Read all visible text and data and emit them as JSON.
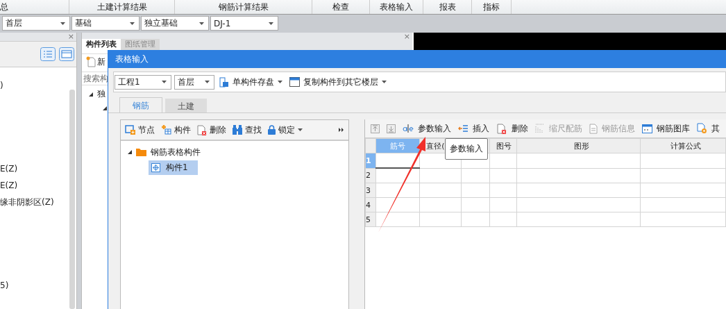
{
  "menu_tabs": [
    {
      "label": "总"
    },
    {
      "label": "土建计算结果"
    },
    {
      "label": "钢筋计算结果"
    },
    {
      "label": "检查"
    },
    {
      "label": "表格输入"
    },
    {
      "label": "报表"
    },
    {
      "label": "指标"
    }
  ],
  "context_bar": {
    "dropdowns": [
      "首层",
      "基础",
      "独立基础",
      "DJ-1"
    ]
  },
  "left_panel": {
    "close": "×",
    "items": [
      ")",
      "E(Z)",
      "E(Z)",
      "缘非阴影区(Z)",
      "5)"
    ]
  },
  "middle_panel": {
    "tabs": [
      {
        "label": "构件列表",
        "selected": true
      },
      {
        "label": "图纸管理",
        "selected": false
      }
    ],
    "new_button": "新",
    "search": {
      "placeholder": "搜索构"
    },
    "tree": [
      {
        "label": "独",
        "expanded": true
      }
    ],
    "close": "×"
  },
  "dialog": {
    "title": "表格输入",
    "project_dropdown": "工程1",
    "floor_dropdown": "首层",
    "toolbar": [
      {
        "label": "单构件存盘",
        "kind": "save"
      },
      {
        "label": "复制构件到其它楼层",
        "kind": "copy"
      }
    ],
    "tabs": [
      {
        "label": "钢筋",
        "selected": true
      },
      {
        "label": "土建",
        "selected": false
      }
    ],
    "tree_toolbar": [
      {
        "label": "节点",
        "kind": "node"
      },
      {
        "label": "构件",
        "kind": "part"
      },
      {
        "label": "删除",
        "kind": "delete"
      },
      {
        "label": "查找",
        "kind": "find"
      },
      {
        "label": "锁定",
        "kind": "lock"
      }
    ],
    "tree": [
      {
        "label": "钢筋表格构件",
        "expanded": true,
        "selected": false,
        "children": [
          {
            "label": "构件1",
            "selected": true
          }
        ]
      }
    ],
    "table_toolbar": [
      {
        "kind": "up",
        "disabled": true
      },
      {
        "kind": "down",
        "disabled": true
      },
      {
        "label": "参数输入",
        "kind": "param",
        "disabled": false
      },
      {
        "label": "插入",
        "kind": "insert",
        "disabled": false
      },
      {
        "label": "删除",
        "kind": "delete",
        "disabled": false
      },
      {
        "label": "缩尺配筋",
        "kind": "scale",
        "disabled": true
      },
      {
        "label": "钢筋信息",
        "kind": "info",
        "disabled": true
      },
      {
        "label": "钢筋图库",
        "kind": "library",
        "disabled": false
      },
      {
        "label": "其",
        "kind": "other",
        "disabled": false
      }
    ],
    "table": {
      "columns": [
        {
          "label": "筋号",
          "selected": true
        },
        {
          "label": "直径(",
          "selected": false
        },
        {},
        {
          "label": "图号",
          "selected": false
        },
        {
          "label": "图形",
          "selected": false
        },
        {
          "label": "计算公式",
          "selected": false
        }
      ],
      "rows": [
        {
          "number": "1",
          "selected": true
        },
        {
          "number": "2",
          "selected": false
        },
        {
          "number": "3",
          "selected": false
        },
        {
          "number": "4",
          "selected": false
        },
        {
          "number": "5",
          "selected": false
        }
      ]
    },
    "tooltip": "参数输入"
  }
}
